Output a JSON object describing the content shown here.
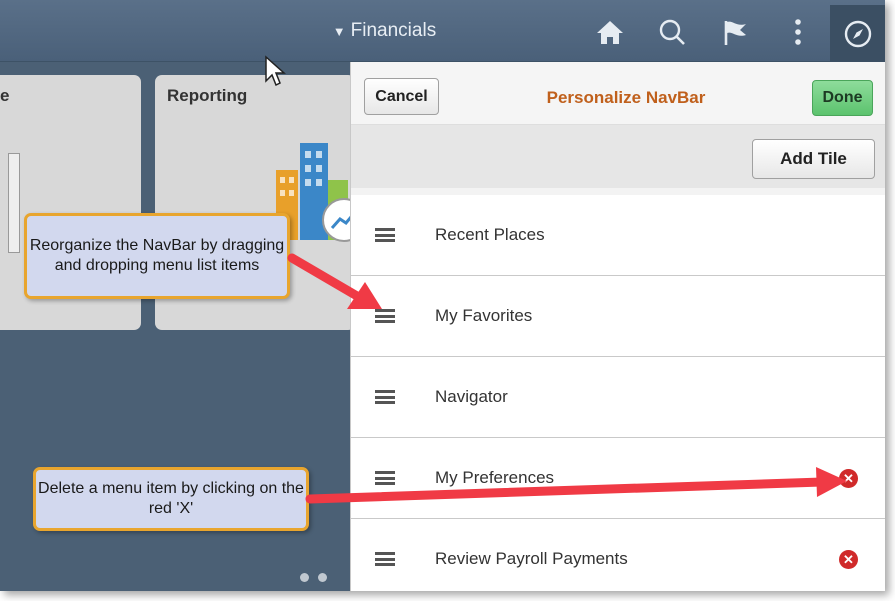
{
  "header": {
    "title": "Financials",
    "icons": [
      "home-icon",
      "search-icon",
      "flag-icon",
      "more-vertical-icon",
      "compass-icon"
    ]
  },
  "tiles": [
    {
      "title": "e"
    },
    {
      "title": "Reporting"
    }
  ],
  "panel": {
    "cancel_label": "Cancel",
    "title": "Personalize NavBar",
    "done_label": "Done",
    "add_tile_label": "Add Tile",
    "items": [
      {
        "label": "Recent Places",
        "deletable": false
      },
      {
        "label": "My Favorites",
        "deletable": false
      },
      {
        "label": "Navigator",
        "deletable": false
      },
      {
        "label": "My Preferences",
        "deletable": true
      },
      {
        "label": "Review Payroll Payments",
        "deletable": true
      }
    ]
  },
  "annotations": {
    "reorganize": "Reorganize the NavBar by dragging and dropping menu list items",
    "delete": "Delete a menu item by clicking on the red 'X'"
  },
  "colors": {
    "header_bg": "#4f657d",
    "panel_title": "#c0601c",
    "done_button": "#6cc77b",
    "delete_icon": "#d02a2a",
    "callout_fill": "#d2d8ee",
    "callout_border": "#e8a52e",
    "arrow": "#f03a45"
  }
}
